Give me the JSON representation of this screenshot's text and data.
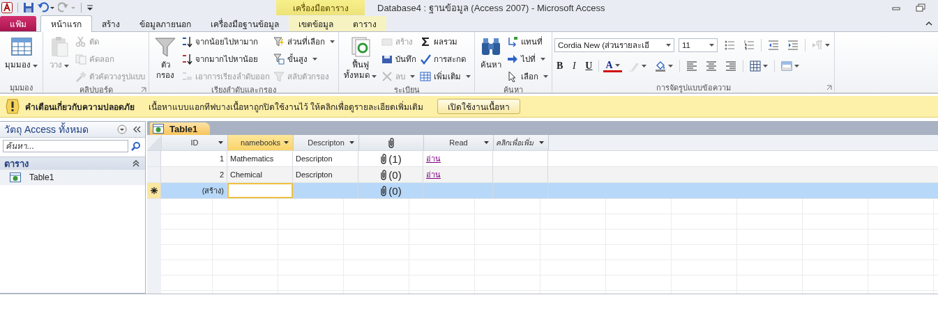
{
  "title_bar": {
    "contextual_tab": "เครื่องมือตาราง",
    "title": "Database4 : ฐานข้อมูล (Access 2007) - Microsoft Access"
  },
  "tabs": [
    {
      "label": "แฟ้ม",
      "kind": "file",
      "selected": false
    },
    {
      "label": "หน้าแรก",
      "kind": "tab",
      "selected": true
    },
    {
      "label": "สร้าง",
      "kind": "tab",
      "selected": false
    },
    {
      "label": "ข้อมูลภายนอก",
      "kind": "tab",
      "selected": false
    },
    {
      "label": "เครื่องมือฐานข้อมูล",
      "kind": "tab",
      "selected": false
    },
    {
      "label": "เขตข้อมูล",
      "kind": "contextual",
      "selected": false
    },
    {
      "label": "ตาราง",
      "kind": "contextual",
      "selected": false
    }
  ],
  "ribbon": {
    "groups": [
      {
        "label": "มุมมอง",
        "kind": "columns",
        "launcher": false,
        "columns": [
          [
            {
              "kind": "large",
              "label": "มุมมอง",
              "dropdown": true,
              "disabled": false
            }
          ]
        ]
      },
      {
        "label": "คลิปบอร์ด",
        "kind": "columns",
        "launcher": true,
        "columns": [
          [
            {
              "kind": "large",
              "label": "วาง",
              "dropdown": true,
              "disabled": true
            }
          ],
          [
            {
              "kind": "small",
              "label": "ตัด",
              "dropdown": false,
              "disabled": true
            },
            {
              "kind": "small",
              "label": "คัดลอก",
              "dropdown": false,
              "disabled": true
            },
            {
              "kind": "small",
              "label": "ตัวคัดวางรูปแบบ",
              "dropdown": false,
              "disabled": true
            }
          ]
        ]
      },
      {
        "label": "เรียงลำดับและกรอง",
        "kind": "columns",
        "launcher": false,
        "columns": [
          [
            {
              "kind": "large",
              "label": "ตัว\nกรอง",
              "dropdown": false,
              "disabled": false
            }
          ],
          [
            {
              "kind": "small",
              "label": "จากน้อยไปหามาก",
              "dropdown": false,
              "disabled": false
            },
            {
              "kind": "small",
              "label": "จากมากไปหาน้อย",
              "dropdown": false,
              "disabled": false
            },
            {
              "kind": "small",
              "label": "เอาการเรียงลำดับออก",
              "dropdown": false,
              "disabled": true
            }
          ],
          [
            {
              "kind": "small",
              "label": "ส่วนที่เลือก",
              "dropdown": true,
              "disabled": false
            },
            {
              "kind": "small",
              "label": "ขั้นสูง",
              "dropdown": true,
              "disabled": false
            },
            {
              "kind": "small",
              "label": "สลับตัวกรอง",
              "dropdown": false,
              "disabled": true
            }
          ]
        ]
      },
      {
        "label": "ระเบียน",
        "kind": "columns",
        "launcher": false,
        "columns": [
          [
            {
              "kind": "large",
              "label": "ฟื้นฟู\nทั้งหมด",
              "dropdown": true,
              "disabled": false
            }
          ],
          [
            {
              "kind": "small",
              "label": "สร้าง",
              "dropdown": false,
              "disabled": true
            },
            {
              "kind": "small",
              "label": "บันทึก",
              "dropdown": false,
              "disabled": false
            },
            {
              "kind": "small",
              "label": "ลบ",
              "dropdown": true,
              "disabled": true
            }
          ],
          [
            {
              "kind": "small",
              "label": "ผลรวม",
              "dropdown": false,
              "disabled": false
            },
            {
              "kind": "small",
              "label": "การสะกด",
              "dropdown": false,
              "disabled": false
            },
            {
              "kind": "small",
              "label": "เพิ่มเติม",
              "dropdown": true,
              "disabled": false
            }
          ]
        ]
      },
      {
        "label": "ค้นหา",
        "kind": "columns",
        "launcher": false,
        "columns": [
          [
            {
              "kind": "large",
              "label": "ค้นหา",
              "dropdown": false,
              "disabled": false
            }
          ],
          [
            {
              "kind": "small",
              "label": "แทนที่",
              "dropdown": false,
              "disabled": false
            },
            {
              "kind": "small",
              "label": "ไปที่",
              "dropdown": true,
              "disabled": false
            },
            {
              "kind": "small",
              "label": "เลือก",
              "dropdown": true,
              "disabled": false
            }
          ]
        ]
      },
      {
        "label": "การจัดรูปแบบข้อความ",
        "kind": "format",
        "launcher": true,
        "lines": [
          {
            "tools": [
              {
                "kind": "combo",
                "value": "Cordia New (ส่วนรายละเอี"
              },
              {
                "kind": "combo",
                "value": "11"
              },
              {
                "kind": "icon",
                "dropdown": false,
                "disabled": false
              },
              {
                "kind": "icon",
                "dropdown": false,
                "disabled": false
              },
              {
                "kind": "separator"
              },
              {
                "kind": "icon",
                "dropdown": false,
                "disabled": false
              },
              {
                "kind": "icon",
                "dropdown": false,
                "disabled": false
              },
              {
                "kind": "separator"
              },
              {
                "kind": "icon",
                "dropdown": true,
                "disabled": true
              }
            ]
          },
          {
            "tools": [
              {
                "kind": "bold",
                "text": "B"
              },
              {
                "kind": "italic",
                "text": "I"
              },
              {
                "kind": "underline",
                "text": "U"
              },
              {
                "kind": "separator"
              },
              {
                "kind": "font-color",
                "text": "A",
                "dropdown": true
              },
              {
                "kind": "icon",
                "dropdown": true,
                "disabled": true
              },
              {
                "kind": "icon",
                "dropdown": true,
                "disabled": false
              },
              {
                "kind": "separator"
              },
              {
                "kind": "icon",
                "dropdown": false,
                "disabled": false
              },
              {
                "kind": "icon",
                "dropdown": false,
                "disabled": false
              },
              {
                "kind": "icon",
                "dropdown": false,
                "disabled": false
              },
              {
                "kind": "separator"
              },
              {
                "kind": "icon",
                "dropdown": true,
                "disabled": false
              },
              {
                "kind": "separator"
              },
              {
                "kind": "icon",
                "dropdown": true,
                "disabled": false
              }
            ]
          }
        ]
      }
    ]
  },
  "security_bar": {
    "title": "คำเตือนเกี่ยวกับความปลอดภัย",
    "message": "เนื้อหาแบบแอกทีฟบางเนื้อหาถูกปิดใช้งานไว้ ให้คลิกเพื่อดูรายละเอียดเพิ่มเติม",
    "button": "เปิดใช้งานเนื้อหา"
  },
  "navigation_pane": {
    "title": "วัตถุ Access ทั้งหมด",
    "search": {
      "placeholder": "ค้นหา..."
    },
    "groups": [
      {
        "label": "ตาราง",
        "expanded": true,
        "items": [
          {
            "label": "Table1",
            "selected": false
          }
        ]
      }
    ]
  },
  "document_tabs": [
    {
      "label": "Table1",
      "selected": true
    }
  ],
  "datasheet": {
    "columns": [
      {
        "label": "ID",
        "kind": "number",
        "selected": false
      },
      {
        "label": "namebooks",
        "kind": "text",
        "selected": true
      },
      {
        "label": "Descripton",
        "kind": "text",
        "selected": false
      },
      {
        "kind": "attachment",
        "selected": false
      },
      {
        "label": "Read",
        "kind": "hyperlink",
        "selected": false
      },
      {
        "label": "คลิกเพื่อเพิ่ม",
        "kind": "add",
        "selected": false
      }
    ],
    "rows": [
      {
        "kind": "record",
        "selected": false,
        "cells": [
          {
            "text": "1",
            "focused": false
          },
          {
            "text": "Mathematics",
            "focused": false
          },
          {
            "text": "Descripton",
            "focused": false
          },
          {
            "text": "(1)",
            "focused": false
          },
          {
            "text": "อ่าน",
            "focused": false
          },
          {
            "focused": false
          }
        ]
      },
      {
        "kind": "record",
        "selected": false,
        "cells": [
          {
            "text": "2",
            "focused": false
          },
          {
            "text": "Chemical",
            "focused": false
          },
          {
            "text": "Descripton",
            "focused": false
          },
          {
            "text": "(0)",
            "focused": false
          },
          {
            "text": "อ่าน",
            "focused": false
          },
          {
            "focused": false
          }
        ]
      },
      {
        "kind": "new",
        "selected": true,
        "cells": [
          {
            "text": "(สร้าง)",
            "focused": false
          },
          {
            "focused": true
          },
          {
            "focused": false
          },
          {
            "text": "(0)",
            "focused": false
          },
          {
            "focused": false
          },
          {
            "focused": false
          }
        ]
      }
    ]
  }
}
